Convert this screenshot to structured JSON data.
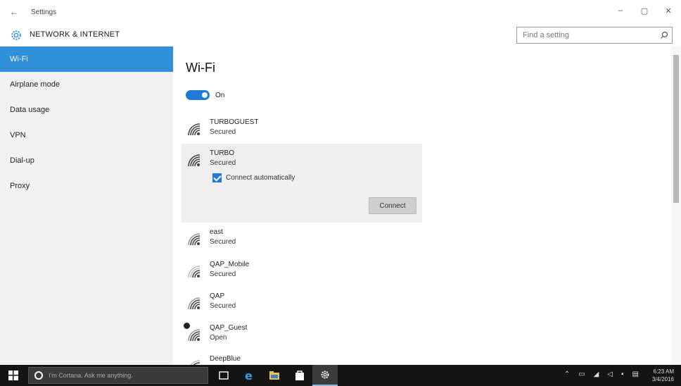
{
  "window": {
    "title": "Settings",
    "back_glyph": "←",
    "minimize_glyph": "–",
    "maximize_glyph": "▢",
    "close_glyph": "✕"
  },
  "header": {
    "section_title": "NETWORK & INTERNET",
    "icon": "gear-icon",
    "search_placeholder": "Find a setting"
  },
  "sidebar": {
    "items": [
      {
        "label": "Wi-Fi",
        "active": true
      },
      {
        "label": "Airplane mode"
      },
      {
        "label": "Data usage"
      },
      {
        "label": "VPN"
      },
      {
        "label": "Dial-up"
      },
      {
        "label": "Proxy"
      }
    ]
  },
  "main": {
    "title": "Wi-Fi",
    "toggle": {
      "label": "On",
      "state": "on"
    },
    "networks": [
      {
        "name": "TURBOGUEST",
        "status": "Secured"
      },
      {
        "name": "TURBO",
        "status": "Secured",
        "expanded": true,
        "connect_auto_label": "Connect automatically",
        "connect_auto_checked": true,
        "connect_button": "Connect"
      },
      {
        "name": "east",
        "status": "Secured"
      },
      {
        "name": "QAP_Mobile",
        "status": "Secured"
      },
      {
        "name": "QAP",
        "status": "Secured"
      },
      {
        "name": "QAP_Guest",
        "status": "Open"
      },
      {
        "name": "DeepBlue",
        "status": ""
      }
    ]
  },
  "taskbar": {
    "cortana_placeholder": "I'm Cortana. Ask me anything.",
    "clock_time": "6:23 AM",
    "clock_date": "3/4/2016",
    "apps": [
      "task-view-icon",
      "edge-icon",
      "file-explorer-icon",
      "store-icon",
      "settings-icon"
    ]
  },
  "colors": {
    "accent": "#2f8fd8",
    "toggle": "#1f7ad6",
    "sidebar_bg": "#f2f2f2",
    "taskbar_bg": "#141414"
  }
}
